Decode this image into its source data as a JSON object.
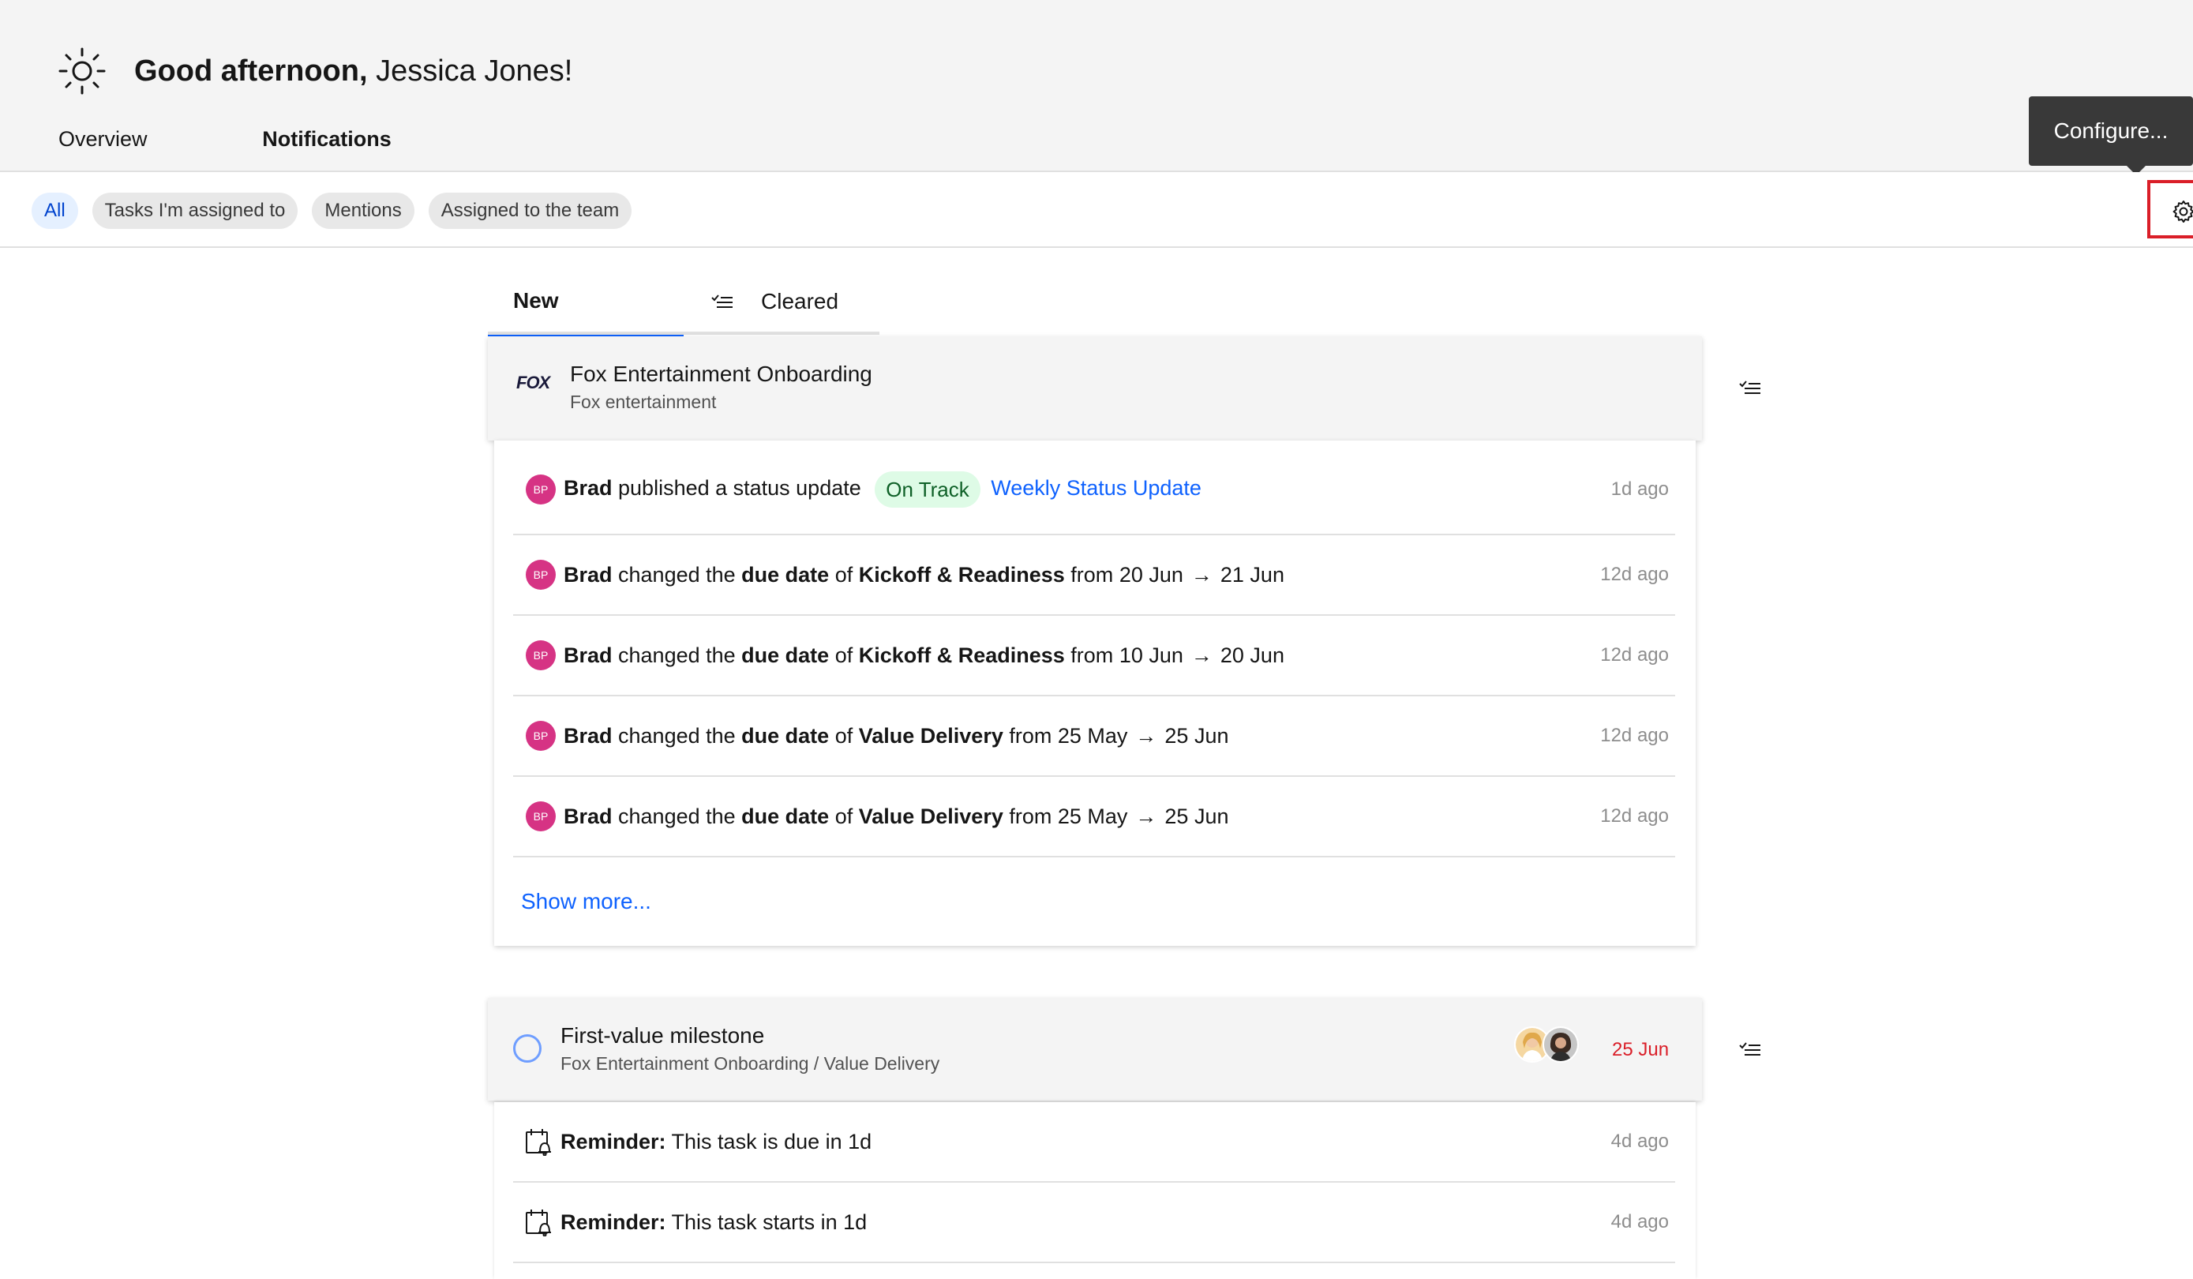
{
  "header": {
    "greeting_bold": "Good afternoon,",
    "greeting_name": " Jessica Jones!",
    "tabs": [
      {
        "label": "Overview"
      },
      {
        "label": "Notifications"
      }
    ],
    "active_tab": "Notifications"
  },
  "tooltip": {
    "label": "Configure..."
  },
  "filters": {
    "chips": [
      {
        "label": "All",
        "active": true
      },
      {
        "label": "Tasks I'm assigned to"
      },
      {
        "label": "Mentions"
      },
      {
        "label": "Assigned to the team"
      }
    ]
  },
  "notif_tabs": {
    "new": "New",
    "cleared": "Cleared"
  },
  "group1": {
    "logo_text": "FOX",
    "title": "Fox Entertainment Onboarding",
    "subtitle": "Fox entertainment",
    "status_row": {
      "avatar": "BP",
      "user": "Brad",
      "action": " published a status update ",
      "tag": "On Track",
      "link": "Weekly Status Update",
      "ago": "1d ago"
    },
    "rows": [
      {
        "avatar": "BP",
        "user": "Brad",
        "t1": " changed the ",
        "field": "due date",
        "t2": " of ",
        "task": "Kickoff & Readiness",
        "t3": " from ",
        "from": "20 Jun",
        "arrow": "→",
        "to": "21 Jun",
        "ago": "12d ago"
      },
      {
        "avatar": "BP",
        "user": "Brad",
        "t1": " changed the ",
        "field": "due date",
        "t2": " of ",
        "task": "Kickoff & Readiness",
        "t3": " from ",
        "from": "10 Jun",
        "arrow": "→",
        "to": "20 Jun",
        "ago": "12d ago"
      },
      {
        "avatar": "BP",
        "user": "Brad",
        "t1": " changed the ",
        "field": "due date",
        "t2": " of ",
        "task": "Value Delivery",
        "t3": " from ",
        "from": "25 May",
        "arrow": "→",
        "to": "25 Jun",
        "ago": "12d ago"
      },
      {
        "avatar": "BP",
        "user": "Brad",
        "t1": " changed the ",
        "field": "due date",
        "t2": " of ",
        "task": "Value Delivery",
        "t3": " from ",
        "from": "25 May",
        "arrow": "→",
        "to": "25 Jun",
        "ago": "12d ago"
      }
    ],
    "show_more": "Show more..."
  },
  "group2": {
    "title": "First-value milestone",
    "subtitle": "Fox Entertainment Onboarding / Value Delivery",
    "due": "25 Jun",
    "rows": [
      {
        "label": "Reminder:",
        "text": " This task is due in 1d",
        "ago": "4d ago"
      },
      {
        "label": "Reminder:",
        "text": " This task starts in 1d",
        "ago": "4d ago"
      }
    ]
  },
  "colors": {
    "accent": "#0f62fe",
    "danger": "#da1e28",
    "success_bg": "#defbe6",
    "avatar": "#d63384"
  }
}
